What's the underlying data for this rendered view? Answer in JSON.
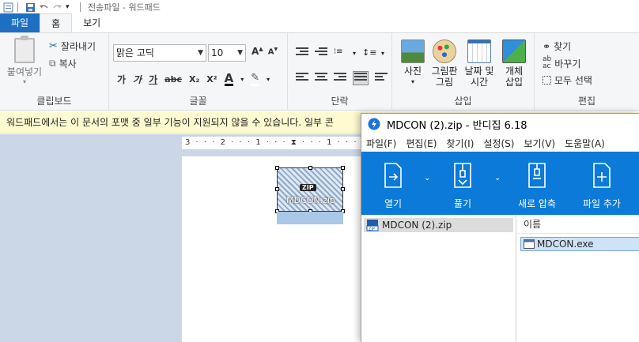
{
  "wordpad": {
    "title": "전송파일 - 워드패드",
    "tabs": [
      {
        "label": "파일"
      },
      {
        "label": "홈"
      },
      {
        "label": "보기"
      }
    ],
    "clipboard": {
      "paste_label": "붙여넣기",
      "cut_label": "잘라내기",
      "copy_label": "복사",
      "group_label": "클립보드"
    },
    "font": {
      "family": "맑은 고딕",
      "size": "10",
      "group_label": "글꼴",
      "format_buttons": [
        "가",
        "가",
        "가",
        "abc",
        "X₂",
        "X²"
      ]
    },
    "paragraph": {
      "group_label": "단락"
    },
    "insert": {
      "picture_label": "사진",
      "paint_label_1": "그림판",
      "paint_label_2": "그림",
      "datetime_label_1": "날짜 및",
      "datetime_label_2": "시간",
      "object_label_1": "개체",
      "object_label_2": "삽입",
      "group_label": "삽입"
    },
    "editing": {
      "find_label": "찾기",
      "replace_label": "바꾸기",
      "select_all_label": "모두 선택",
      "group_label": "편집"
    },
    "infobar": "워드패드에서는 이 문서의 포맷 중 일부 기능이 지원되지 않을 수 있습니다. 일부 콘",
    "ruler": "3 · · · 2 · · · 1 · · · ⧗ · · · 1 · · · 2 · · ·",
    "object": {
      "badge": "ZIP",
      "name": "MDCON.zip"
    }
  },
  "bandizip": {
    "title": "MDCON (2).zip - 반디집 6.18",
    "menu": [
      "파일(F)",
      "편집(E)",
      "찾기(I)",
      "설정(S)",
      "보기(V)",
      "도움말(A)"
    ],
    "toolbar": [
      {
        "label": "열기"
      },
      {
        "label": "풀기"
      },
      {
        "label": "새로 압축"
      },
      {
        "label": "파일 추가"
      }
    ],
    "tree_item": "MDCON (2).zip",
    "column_header": "이름",
    "file": "MDCON.exe"
  },
  "colors": {
    "wordpad_file_tab": "#1e6fc2",
    "bandizip_toolbar": "#0b7ad8",
    "infobar_bg": "#fffbd0"
  }
}
